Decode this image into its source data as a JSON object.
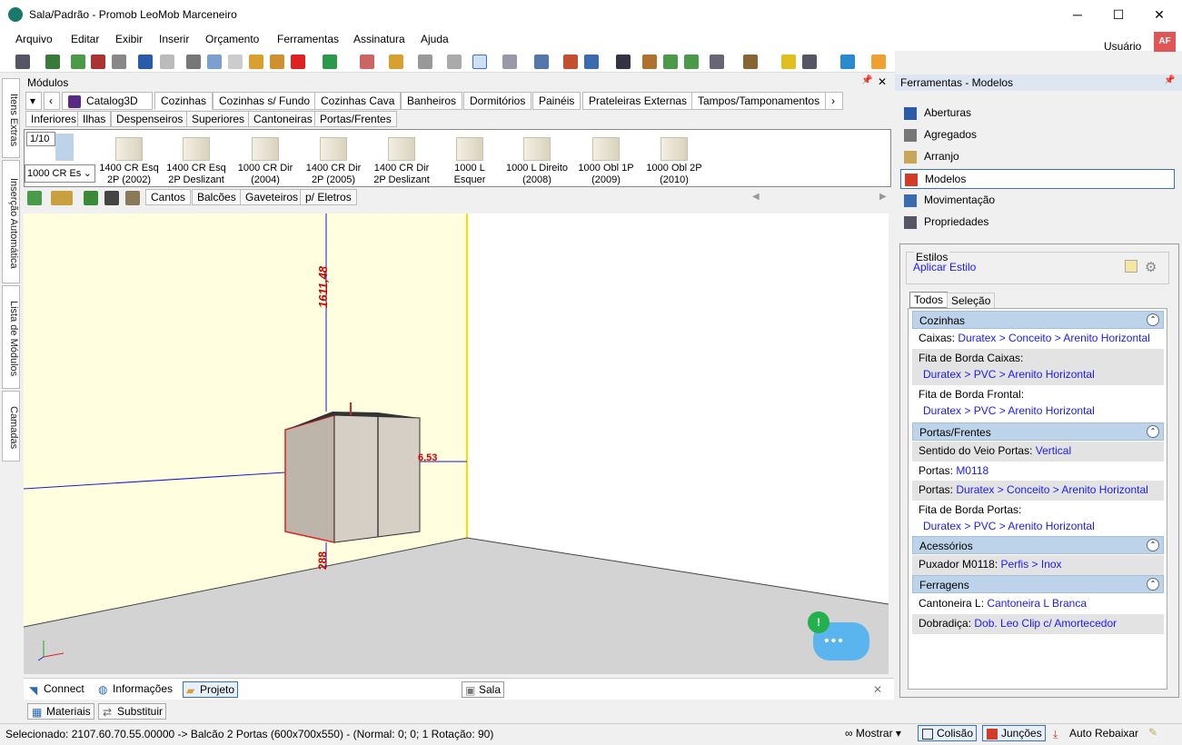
{
  "window": {
    "title": "Sala/Padrão - Promob LeoMob Marceneiro",
    "minimize": "─",
    "maximize": "☐",
    "close": "✕"
  },
  "menu": [
    "Arquivo",
    "Editar",
    "Exibir",
    "Inserir",
    "Orçamento",
    "Ferramentas",
    "Assinatura",
    "Ajuda"
  ],
  "user": {
    "label": "Usuário",
    "initials": "AF"
  },
  "left_rail": [
    "Itens Extras",
    "Inserção Automática",
    "Lista de Módulos",
    "Camadas"
  ],
  "modulos": {
    "title": "Módulos",
    "pin": "📌",
    "close": "✕",
    "tabs": [
      "Catalog3D",
      "Cozinhas",
      "Cozinhas s/ Fundo",
      "Cozinhas Cava",
      "Banheiros",
      "Dormitórios",
      "Painéis",
      "Prateleiras Externas",
      "Tampos/Tamponamentos"
    ],
    "active_tab": "Cozinhas",
    "subtabs": [
      "Inferiores",
      "Ilhas",
      "Despenseiros",
      "Superiores",
      "Cantoneiras",
      "Portas/Frentes"
    ],
    "active_subtab": "Inferiores",
    "page": "1/10",
    "dropdown_value": "1000 CR Es",
    "thumbnails": [
      {
        "line1": "1400 CR Esq",
        "line2": "2P (2002)"
      },
      {
        "line1": "1400 CR Esq",
        "line2": "2P Deslizant"
      },
      {
        "line1": "1000 CR Dir",
        "line2": "(2004)"
      },
      {
        "line1": "1400 CR Dir",
        "line2": "2P (2005)"
      },
      {
        "line1": "1400 CR Dir",
        "line2": "2P Deslizant"
      },
      {
        "line1": "1000 L",
        "line2": "Esquer"
      },
      {
        "line1": "1000 L Direito",
        "line2": "(2008)"
      },
      {
        "line1": "1000 Obl 1P",
        "line2": "(2009)"
      },
      {
        "line1": "1000 Obl 2P",
        "line2": "(2010)"
      }
    ],
    "view_tabs": [
      "Cantos",
      "Balcões",
      "Gaveteiros",
      "p/ Eletros"
    ],
    "active_view_tab": "Cantos"
  },
  "viewport": {
    "dim_top": "1611,48",
    "dim_right": "6,53",
    "dim_bottom": "288",
    "chat_badge": "!",
    "chat_dots": "•••"
  },
  "bottom_tabs": [
    "Connect",
    "Informações",
    "Projeto"
  ],
  "active_bottom_tab": "Projeto",
  "document_tab": "Sala",
  "lower_tabs": [
    "Materiais",
    "Substituir"
  ],
  "sidebar": {
    "title": "Ferramentas - Modelos",
    "pin": "📌",
    "items": [
      "Aberturas",
      "Agregados",
      "Arranjo",
      "Modelos",
      "Movimentação",
      "Propriedades"
    ],
    "active_item": "Modelos",
    "estilos": {
      "label": "Estilos",
      "action": "Aplicar Estilo"
    },
    "filter_tabs": [
      "Todos",
      "Seleção"
    ],
    "groups": [
      {
        "name": "Cozinhas",
        "props": [
          {
            "label": "Caixas:",
            "value": "Duratex > Conceito > Arenito Horizontal",
            "inline": true
          },
          {
            "label": "Fita de Borda Caixas:",
            "value": "Duratex > PVC > Arenito Horizontal",
            "inline": false
          },
          {
            "label": "Fita de Borda Frontal:",
            "value": "Duratex > PVC > Arenito Horizontal",
            "inline": false
          }
        ]
      },
      {
        "name": "Portas/Frentes",
        "props": [
          {
            "label": "Sentido do Veio Portas:",
            "value": "Vertical",
            "inline": true
          },
          {
            "label": "Portas:",
            "value": "M0118",
            "inline": true
          },
          {
            "label": "Portas:",
            "value": "Duratex > Conceito > Arenito Horizontal",
            "inline": true
          },
          {
            "label": "Fita de Borda Portas:",
            "value": "Duratex > PVC > Arenito Horizontal",
            "inline": false
          }
        ]
      },
      {
        "name": "Acessórios",
        "props": [
          {
            "label": "Puxador M0118:",
            "value": "Perfis > Inox",
            "inline": true
          }
        ]
      },
      {
        "name": "Ferragens",
        "props": [
          {
            "label": "Cantoneira L:",
            "value": "Cantoneira L Branca",
            "inline": true
          },
          {
            "label": "Dobradiça:",
            "value": "Dob. Leo Clip c/ Amortecedor",
            "inline": true
          }
        ]
      }
    ]
  },
  "status": {
    "text": "Selecionado: 2107.60.70.55.00000 -> Balcão 2 Portas (600x700x550) - (Normal: 0; 0; 1 Rotação: 90)",
    "mostrar": "Mostrar",
    "colisao": "Colisão",
    "juncoes": "Junções",
    "auto_rebaixar": "Auto Rebaixar"
  },
  "colors": {
    "accent": "#bcd3ea",
    "link": "#1a1aff",
    "wall": "#ffffe0",
    "floor": "#d3d3d3"
  }
}
